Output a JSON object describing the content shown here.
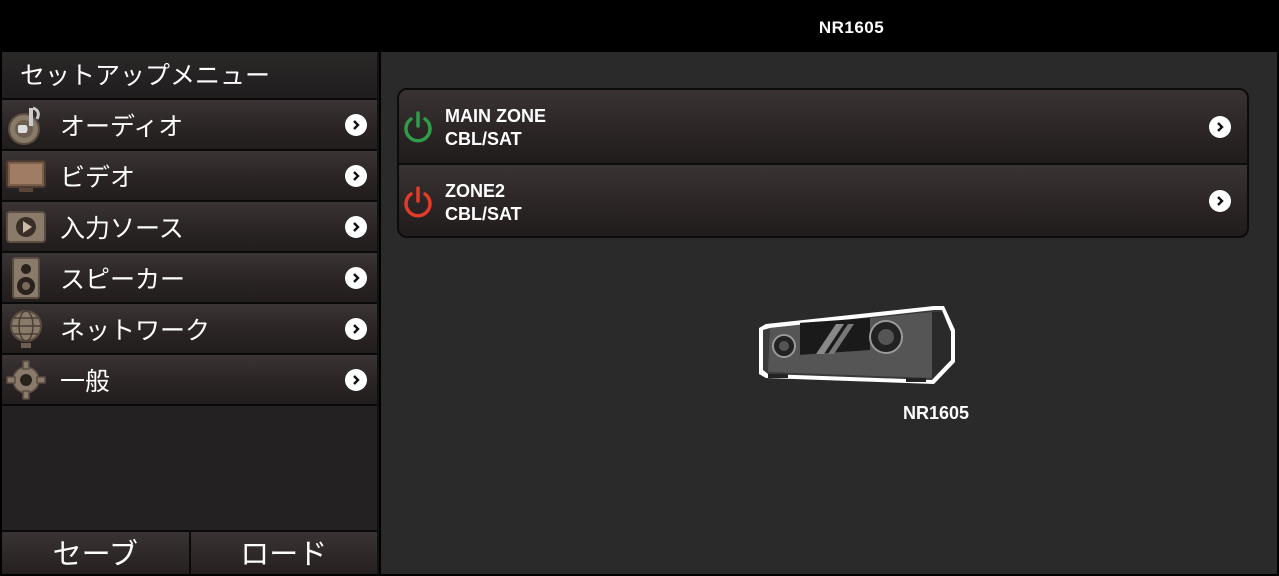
{
  "window": {
    "title": "NR1605"
  },
  "sidebar": {
    "header": "セットアップメニュー",
    "items": [
      {
        "label": "オーディオ",
        "icon": "audio-icon"
      },
      {
        "label": "ビデオ",
        "icon": "video-icon"
      },
      {
        "label": "入力ソース",
        "icon": "input-source-icon"
      },
      {
        "label": "スピーカー",
        "icon": "speaker-icon"
      },
      {
        "label": "ネットワーク",
        "icon": "network-icon"
      },
      {
        "label": "一般",
        "icon": "gear-icon"
      }
    ],
    "footer": {
      "save": "セーブ",
      "load": "ロード"
    }
  },
  "zones": [
    {
      "name": "MAIN ZONE",
      "source": "CBL/SAT",
      "power_color": "#2e9d4a",
      "icon": "power-icon"
    },
    {
      "name": "ZONE2",
      "source": "CBL/SAT",
      "power_color": "#e23b2a",
      "icon": "power-icon"
    }
  ],
  "device": {
    "name": "NR1605",
    "icon": "av-receiver-icon"
  }
}
